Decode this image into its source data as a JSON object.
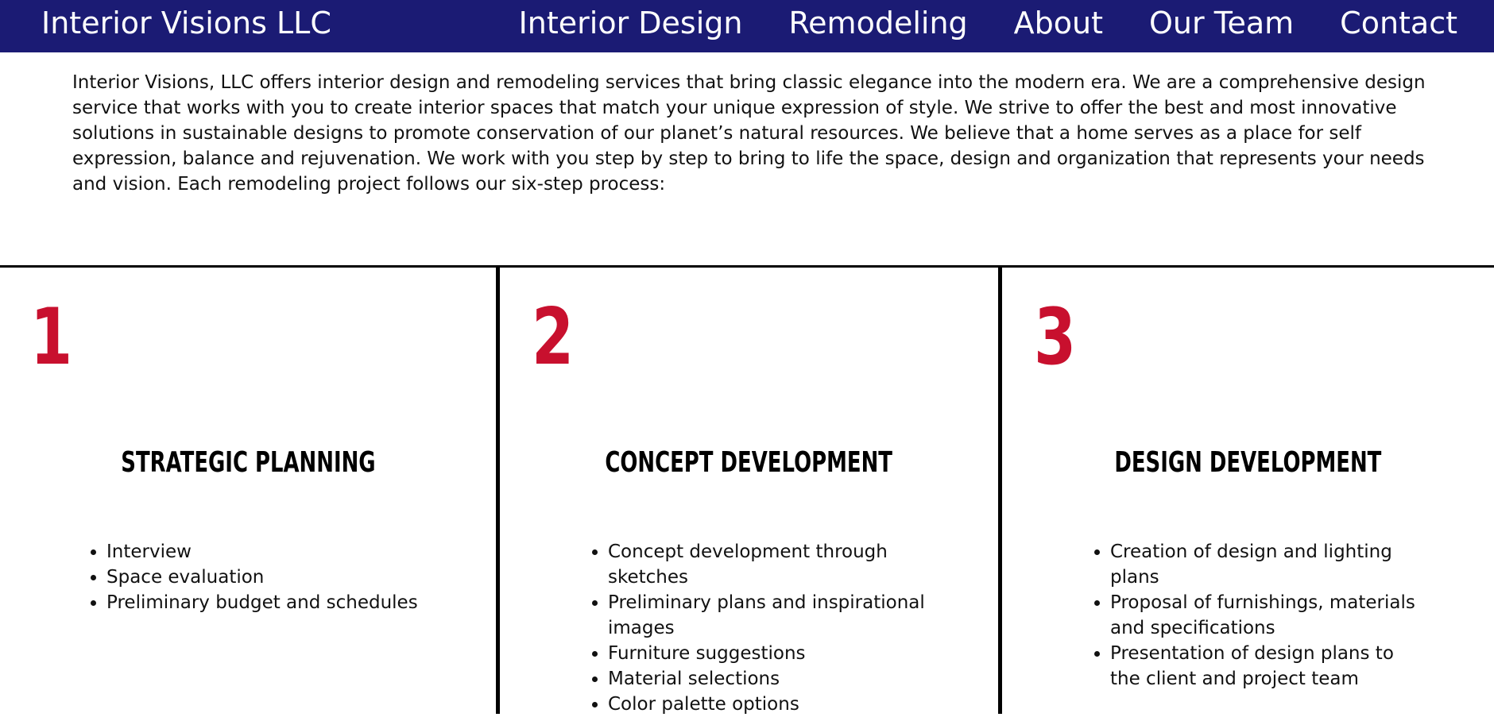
{
  "header": {
    "brand": "Interior Visions LLC",
    "nav": [
      {
        "label": "Interior Design"
      },
      {
        "label": "Remodeling"
      },
      {
        "label": "About"
      },
      {
        "label": "Our Team"
      },
      {
        "label": "Contact"
      }
    ]
  },
  "intro": {
    "text": "Interior Visions, LLC offers interior design and remodeling services that bring classic elegance into the modern era. We are a comprehensive design service that works with you to create interior spaces that match your unique expression of style. We strive to offer the best and most innovative solutions in sustainable designs to promote conservation of our planet’s natural resources. We believe that a home serves as a place for self expression, balance and rejuvenation. We work with you step by step to bring to life the space, design and organization that represents your needs and vision. Each remodeling project follows our six-step process:"
  },
  "colors": {
    "navbar": "#1b1b74",
    "accent": "#c8102e",
    "text": "#111111"
  },
  "steps": [
    {
      "number": "1",
      "title": "Strategic Planning",
      "items": [
        "Interview",
        "Space evaluation",
        "Preliminary budget and schedules"
      ]
    },
    {
      "number": "2",
      "title": "Concept Development",
      "items": [
        "Concept development through sketches",
        "Preliminary plans and inspirational images",
        "Furniture suggestions",
        "Material selections",
        "Color palette options"
      ]
    },
    {
      "number": "3",
      "title": "Design Development",
      "items": [
        "Creation of design and lighting plans",
        "Proposal of furnishings, materials and specifications",
        "Presentation of design plans to the client and project team"
      ]
    }
  ]
}
